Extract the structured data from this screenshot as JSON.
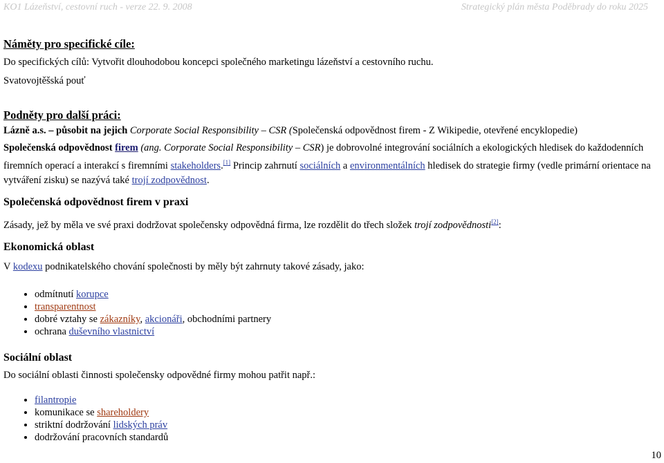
{
  "header": {
    "left": "KO1 Lázeňství, cestovní ruch - verze 22. 9. 2008",
    "right": "Strategický plán města Poděbrady do roku 2025"
  },
  "namety": {
    "heading": "Náměty pro specifické cíle:",
    "line1": "Do specifických cílů: Vytvořit dlouhodobou koncepci společného marketingu lázeňství a cestovního ruchu.",
    "line2": "Svatovojtěšská pouť"
  },
  "podnety": {
    "heading": "Podněty pro další práci:",
    "bold_part": "Lázně a.s. – působit na jejich",
    "italic_part": " Corporate Social Responsibility – CSR (",
    "rest": "Společenská odpovědnost firem - Z Wikipedie, otevřené encyklopedie)"
  },
  "definition": {
    "bold_term": "Společenská odpovědnost",
    "firem_link": "firem",
    "ang_italic": "(ang. Corporate Social Responsibility – CSR",
    "text1": ") je dobrovolné integrování sociálních a ekologických hledisek do každodenních firemních operací a interakcí s firemními ",
    "stakeholders_link": "stakeholders",
    "dot": ".",
    "ref1": "[1]",
    "text2": " Princip zahrnutí ",
    "socialnich_link": "sociálních",
    "a_text": " a ",
    "environment_link": "environmentálních",
    "text3": " hledisek do strategie firmy (vedle primární orientace na vytváření zisku) se nazývá také ",
    "troji_link": "trojí zodpovědnost",
    "end": "."
  },
  "praxe": {
    "heading": "Společenská odpovědnost firem v praxi",
    "text": "Zásady, jež by měla ve své praxi dodržovat společensky odpovědná firma, lze rozdělit do třech složek ",
    "italic": "trojí zodpovědnosti",
    "ref2": "[2]",
    "colon": ":"
  },
  "ekonomicka": {
    "heading": "Ekonomická oblast",
    "intro_pre": "V ",
    "kodexu_link": "kodexu",
    "intro_post": " podnikatelského chování společnosti by měly být zahrnuty takové zásady, jako:",
    "items": [
      {
        "pre": "odmítnutí ",
        "link": "korupce",
        "post": ""
      },
      {
        "pre": "",
        "link": "transparentnost",
        "post": ""
      },
      {
        "pre": "dobré vztahy se ",
        "link": "zákazníky",
        "mid": ", ",
        "link2": "akcionáři",
        "post": ", obchodními partnery"
      },
      {
        "pre": "ochrana ",
        "link": "duševního vlastnictví",
        "post": ""
      }
    ]
  },
  "socialni": {
    "heading": "Sociální oblast",
    "intro": "Do sociální oblasti činnosti společensky odpovědné firmy mohou patřit např.:",
    "items": [
      {
        "pre": "",
        "link": "filantropie",
        "post": ""
      },
      {
        "pre": "komunikace se ",
        "link": "shareholdery",
        "post": ""
      },
      {
        "pre": "striktní dodržování ",
        "link": "lidských práv",
        "post": ""
      },
      {
        "pre": "dodržování pracovních standardů",
        "link": "",
        "post": ""
      }
    ]
  },
  "page_number": "10",
  "colors": {
    "header_text": "#c7c7c7",
    "link_blue": "#2b3fa0",
    "link_red": "#a03a12",
    "link_dark": "#1a1a6e"
  }
}
